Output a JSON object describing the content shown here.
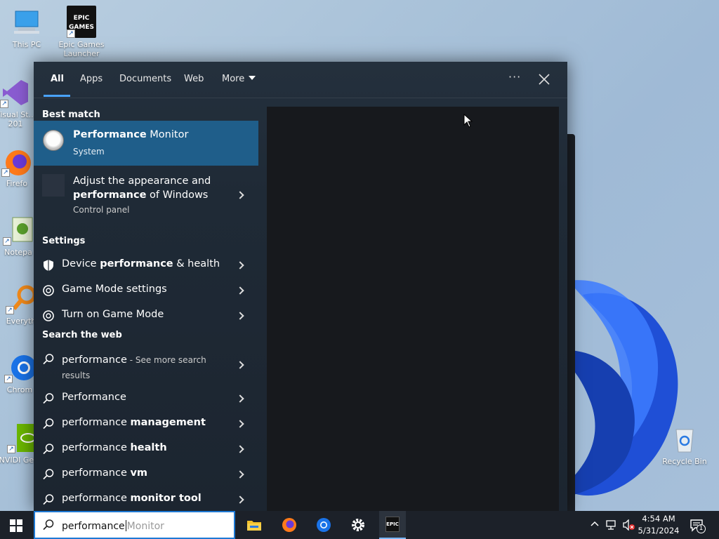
{
  "desktop": {
    "icons": [
      {
        "label": "This PC"
      },
      {
        "label": "Epic Games Launcher",
        "logo_text": "EPIC GAMES"
      },
      {
        "label": "Visual St... 201"
      },
      {
        "label": "Firefo"
      },
      {
        "label": "Notepa"
      },
      {
        "label": "Everyth"
      },
      {
        "label": "Chrom"
      },
      {
        "label": "NVIDI GeFor"
      },
      {
        "label": "Recycle Bin"
      }
    ]
  },
  "search_panel": {
    "tabs": [
      {
        "label": "All",
        "active": true
      },
      {
        "label": "Apps"
      },
      {
        "label": "Documents"
      },
      {
        "label": "Web"
      },
      {
        "label": "More"
      }
    ],
    "more_options": "···",
    "best_match": {
      "heading": "Best match",
      "title_bold": "Performance",
      "title_rest": " Monitor",
      "subtitle": "System"
    },
    "adjust": {
      "line1": "Adjust the appearance and",
      "line2_bold": "performance",
      "line2_rest": " of Windows",
      "subtitle": "Control panel"
    },
    "settings": {
      "heading": "Settings",
      "items": [
        {
          "pre": "Device ",
          "bold": "performance",
          "post": " & health",
          "icon": "shield-icon"
        },
        {
          "pre": "Game Mode settings",
          "bold": "",
          "post": "",
          "icon": "game-mode-icon"
        },
        {
          "pre": "Turn on Game Mode",
          "bold": "",
          "post": "",
          "icon": "game-mode-icon"
        }
      ]
    },
    "web": {
      "heading": "Search the web",
      "first": {
        "text": "performance",
        "suffix": " - See more search",
        "suffix2": "results"
      },
      "items": [
        {
          "pre": "Performance",
          "bold": ""
        },
        {
          "pre": "performance ",
          "bold": "management"
        },
        {
          "pre": "performance ",
          "bold": "health"
        },
        {
          "pre": "performance ",
          "bold": "vm"
        },
        {
          "pre": "performance ",
          "bold": "monitor tool"
        }
      ]
    }
  },
  "taskbar": {
    "search_typed": "performance",
    "search_suggest": "Monitor",
    "pinned": [
      "file-explorer-icon",
      "firefox-icon",
      "chrome-icon",
      "settings-icon",
      "epic-games-icon"
    ],
    "epic_logo": "EPIC",
    "time": "4:54 AM",
    "date": "5/31/2024",
    "notification_count": "1"
  }
}
